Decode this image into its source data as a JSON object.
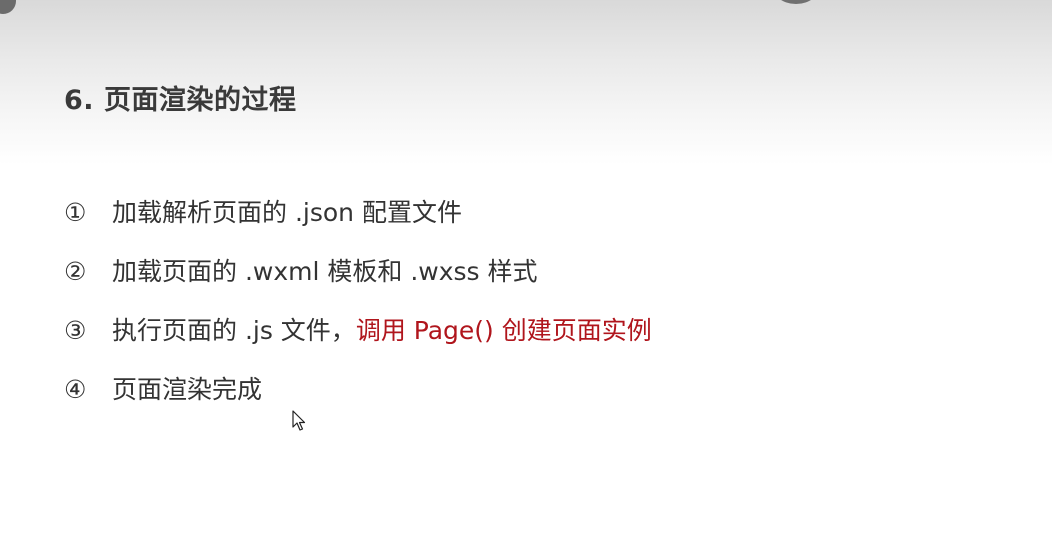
{
  "title": "6. 页面渲染的过程",
  "steps": [
    {
      "num": "①",
      "text": "加载解析页面的 .json 配置文件",
      "highlight": ""
    },
    {
      "num": "②",
      "text": "加载页面的 .wxml 模板和 .wxss 样式",
      "highlight": ""
    },
    {
      "num": "③",
      "text": "执行页面的 .js 文件，",
      "highlight": "调用 Page() 创建页面实例"
    },
    {
      "num": "④",
      "text": "页面渲染完成",
      "highlight": ""
    }
  ],
  "colors": {
    "title": "#3a3a3a",
    "body_text": "#333333",
    "highlight": "#b0151c"
  },
  "icons": {
    "cursor": "mouse-pointer-icon"
  }
}
